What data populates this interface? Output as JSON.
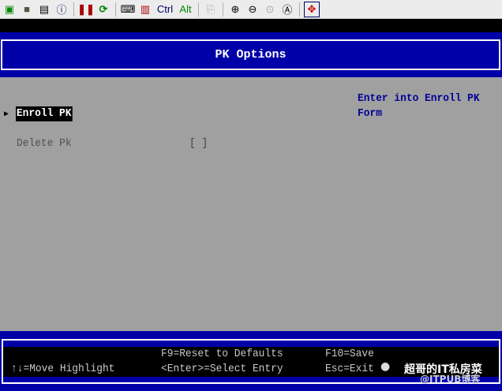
{
  "toolbar": {
    "icons": [
      "network-icon",
      "save-icon",
      "properties-icon",
      "info-icon",
      "pause-icon",
      "refresh-icon",
      "keyboard-icon",
      "macro-icon",
      "ctrl-key",
      "alt-key",
      "copy-icon",
      "zoom-in-icon",
      "zoom-out-icon",
      "zoom-100-icon",
      "zoom-fit-icon",
      "fullscreen-icon"
    ],
    "ctrl_label": "Ctrl",
    "alt_label": "Alt"
  },
  "header": {
    "title": "PK Options"
  },
  "menu": {
    "items": [
      {
        "label": "Enroll PK",
        "selected": true
      },
      {
        "label": "Delete Pk",
        "value": "[ ]"
      }
    ]
  },
  "help": {
    "line1": "Enter into Enroll PK",
    "line2": "Form"
  },
  "footer": {
    "move": "↑↓=Move Highlight",
    "reset": "F9=Reset to Defaults",
    "select": "<Enter>=Select Entry",
    "save": "F10=Save",
    "exit": "Esc=Exit"
  },
  "watermark": {
    "line1": "超哥的IT私房菜",
    "line2": "@ITPUB博客"
  },
  "colors": {
    "blue": "#0000a8",
    "gray": "#a0a0a0",
    "help_text": "#000098"
  }
}
